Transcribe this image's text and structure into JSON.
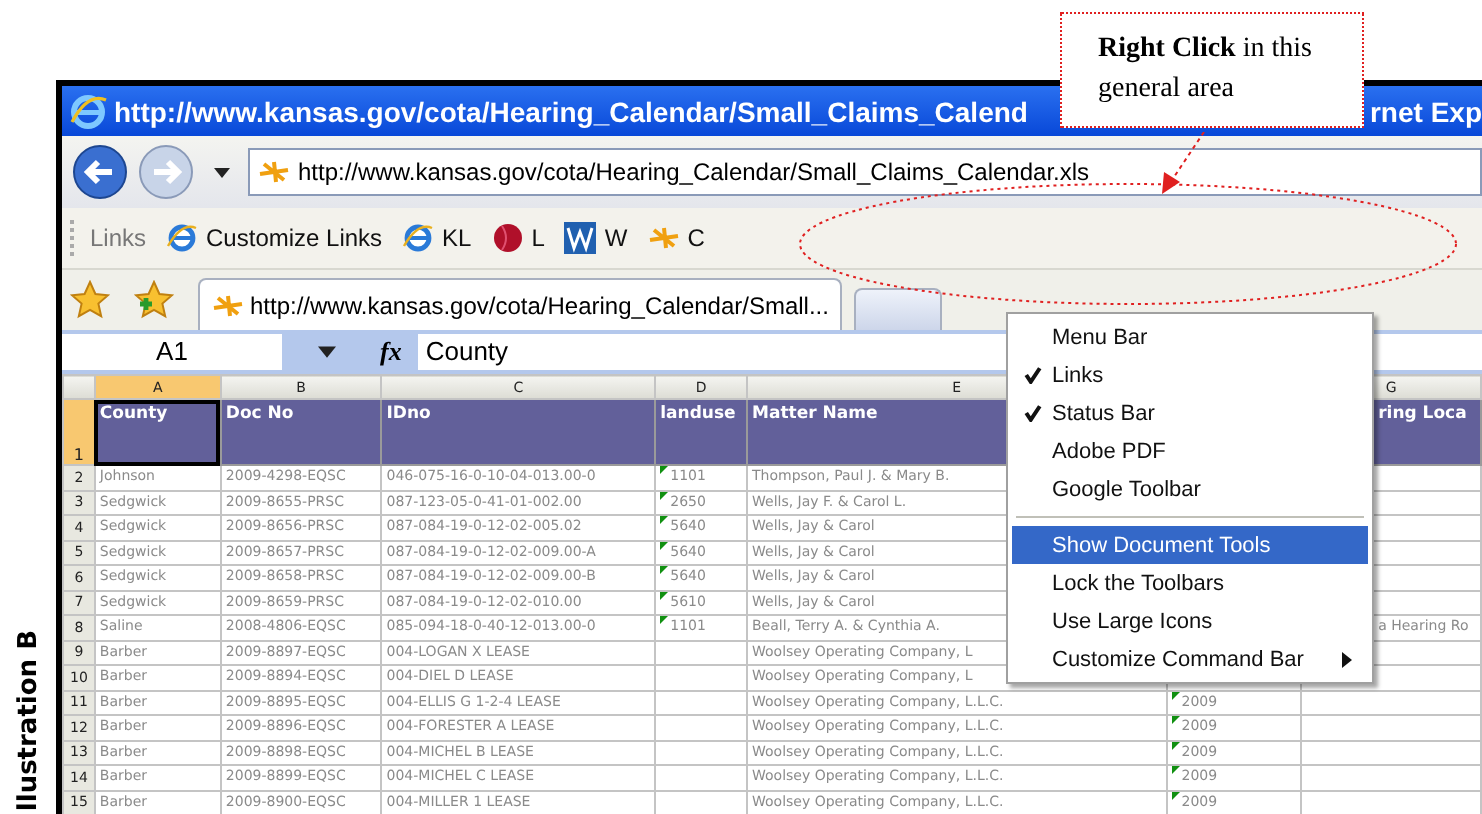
{
  "callout": {
    "text": "**Right Click** in this general area"
  },
  "side_label": "llustration B",
  "browser": {
    "title": "http://www.kansas.gov/cota/Hearing_Calendar/Small_Claims_Calend",
    "title_tail": "rnet Exp",
    "address": "http://www.kansas.gov/cota/Hearing_Calendar/Small_Claims_Calendar.xls",
    "links_label": "Links",
    "links": [
      {
        "kind": "ie",
        "label": "Customize Links"
      },
      {
        "kind": "ie",
        "label": "KL"
      },
      {
        "kind": "ball",
        "label": "L"
      },
      {
        "kind": "w",
        "label": "W"
      },
      {
        "kind": "star",
        "label": "C"
      }
    ],
    "tabs": [
      {
        "label": "http://www.kansas.gov/cota/Hearing_Calendar/Small...",
        "selected": true
      },
      {
        "selected": false
      }
    ]
  },
  "formula_bar": {
    "cell": "A1",
    "fx": "fx",
    "value": "County"
  },
  "sheet": {
    "columns": [
      {
        "letter": "A",
        "selected": true
      },
      {
        "letter": "B",
        "selected": false
      },
      {
        "letter": "C",
        "selected": false
      },
      {
        "letter": "D",
        "selected": false
      },
      {
        "letter": "E",
        "selected": false
      },
      {},
      {
        "letter": "G",
        "selected": false
      }
    ],
    "rows": [
      {
        "num": "1",
        "kind": "header",
        "selected": true,
        "cells": [
          "County",
          "Doc No",
          "IDno",
          "landuse",
          "Matter Name",
          null,
          "ring Loca"
        ]
      },
      {
        "num": "2",
        "kind": "data",
        "selected": false,
        "cells": [
          "Johnson",
          "2009-4298-EQSC",
          "046-075-16-0-10-04-013.00-0",
          {
            "text": "1101",
            "flag": true
          },
          "Thompson, Paul J. & Mary B.",
          null,
          null
        ]
      },
      {
        "num": "3",
        "kind": "data",
        "selected": false,
        "cells": [
          "Sedgwick",
          "2009-8655-PRSC",
          "087-123-05-0-41-01-002.00",
          {
            "text": "2650",
            "flag": true
          },
          "Wells, Jay F. & Carol L.",
          null,
          null
        ]
      },
      {
        "num": "4",
        "kind": "data",
        "selected": false,
        "cells": [
          "Sedgwick",
          "2009-8656-PRSC",
          "087-084-19-0-12-02-005.02",
          {
            "text": "5640",
            "flag": true
          },
          "Wells, Jay & Carol",
          null,
          null
        ]
      },
      {
        "num": "5",
        "kind": "data",
        "selected": false,
        "cells": [
          "Sedgwick",
          "2009-8657-PRSC",
          "087-084-19-0-12-02-009.00-A",
          {
            "text": "5640",
            "flag": true
          },
          "Wells, Jay & Carol",
          null,
          null
        ]
      },
      {
        "num": "6",
        "kind": "data",
        "selected": false,
        "cells": [
          "Sedgwick",
          "2009-8658-PRSC",
          "087-084-19-0-12-02-009.00-B",
          {
            "text": "5640",
            "flag": true
          },
          "Wells, Jay & Carol",
          null,
          null
        ]
      },
      {
        "num": "7",
        "kind": "data",
        "selected": false,
        "cells": [
          "Sedgwick",
          "2009-8659-PRSC",
          "087-084-19-0-12-02-010.00",
          {
            "text": "5610",
            "flag": true
          },
          "Wells, Jay & Carol",
          null,
          null
        ]
      },
      {
        "num": "8",
        "kind": "data",
        "selected": false,
        "cells": [
          "Saline",
          "2008-4806-EQSC",
          "085-094-18-0-40-12-013.00-0",
          {
            "text": "1101",
            "flag": true
          },
          "Beall, Terry A. & Cynthia A.",
          null,
          "a Hearing Ro"
        ]
      },
      {
        "num": "9",
        "kind": "data",
        "selected": false,
        "cells": [
          "Barber",
          "2009-8897-EQSC",
          "004-LOGAN X LEASE",
          null,
          "Woolsey Operating Company, L",
          null,
          null
        ]
      },
      {
        "num": "10",
        "kind": "data",
        "selected": false,
        "cells": [
          "Barber",
          "2009-8894-EQSC",
          "004-DIEL D LEASE",
          null,
          "Woolsey Operating Company, L",
          null,
          null
        ]
      },
      {
        "num": "11",
        "kind": "data",
        "selected": false,
        "cells": [
          "Barber",
          "2009-8895-EQSC",
          "004-ELLIS G 1-2-4 LEASE",
          null,
          "Woolsey Operating Company, L.L.C.",
          {
            "text": "2009",
            "flag": true
          },
          null
        ]
      },
      {
        "num": "12",
        "kind": "data",
        "selected": false,
        "cells": [
          "Barber",
          "2009-8896-EQSC",
          "004-FORESTER A LEASE",
          null,
          "Woolsey Operating Company, L.L.C.",
          {
            "text": "2009",
            "flag": true
          },
          null
        ]
      },
      {
        "num": "13",
        "kind": "data",
        "selected": false,
        "cells": [
          "Barber",
          "2009-8898-EQSC",
          "004-MICHEL B LEASE",
          null,
          "Woolsey Operating Company, L.L.C.",
          {
            "text": "2009",
            "flag": true
          },
          null
        ]
      },
      {
        "num": "14",
        "kind": "data",
        "selected": false,
        "cells": [
          "Barber",
          "2009-8899-EQSC",
          "004-MICHEL C LEASE",
          null,
          "Woolsey Operating Company, L.L.C.",
          {
            "text": "2009",
            "flag": true
          },
          null
        ]
      },
      {
        "num": "15",
        "kind": "data",
        "selected": false,
        "cells": [
          "Barber",
          "2009-8900-EQSC",
          "004-MILLER 1 LEASE",
          null,
          "Woolsey Operating Company, L.L.C.",
          {
            "text": "2009",
            "flag": true
          },
          null
        ]
      }
    ]
  },
  "context_menu": [
    {
      "kind": "item",
      "label": "Menu Bar",
      "checked": false,
      "selected": false
    },
    {
      "kind": "item",
      "label": "Links",
      "checked": true,
      "selected": false
    },
    {
      "kind": "item",
      "label": "Status Bar",
      "checked": true,
      "selected": false
    },
    {
      "kind": "item",
      "label": "Adobe PDF",
      "checked": false,
      "selected": false
    },
    {
      "kind": "item",
      "label": "Google Toolbar",
      "checked": false,
      "selected": false
    },
    {
      "kind": "separator"
    },
    {
      "kind": "item",
      "label": "Show Document Tools",
      "checked": false,
      "selected": true
    },
    {
      "kind": "item",
      "label": "Lock the Toolbars",
      "checked": false,
      "selected": false
    },
    {
      "kind": "item",
      "label": "Use Large Icons",
      "checked": false,
      "selected": false
    },
    {
      "kind": "submenu",
      "label": "Customize Command Bar",
      "checked": false,
      "selected": false
    }
  ]
}
